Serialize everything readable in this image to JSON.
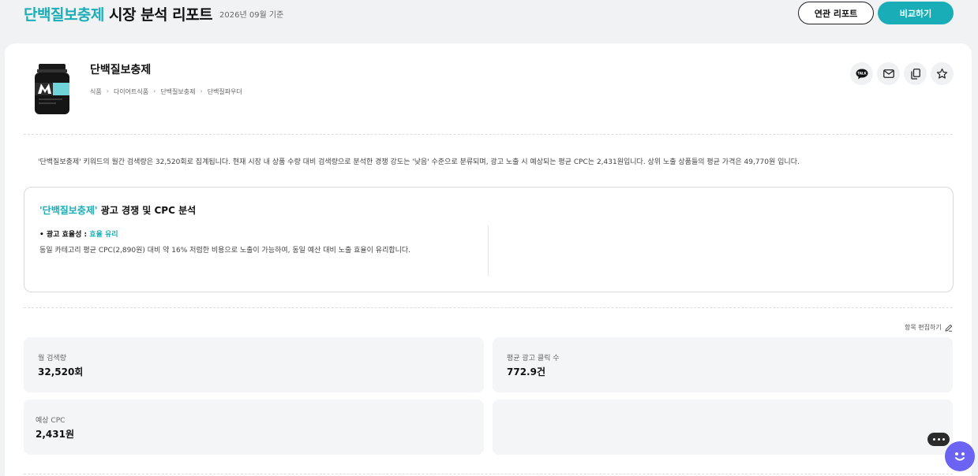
{
  "header": {
    "title_keyword": "단백질보충제",
    "title_rest": " 시장 분석 리포트",
    "date": "2026년 09월 기준",
    "related_report_label": "연관 리포트",
    "compare_label": "비교하기"
  },
  "product": {
    "name": "단백질보충제",
    "breadcrumb": [
      "식품",
      "다이어트식품",
      "단백질보충제",
      "단백질파우더"
    ],
    "breadcrumb_sep": "›",
    "actions": [
      "talk-icon",
      "mail-icon",
      "copy-icon",
      "star-icon"
    ],
    "talk_label": "TALK"
  },
  "summary": "'단백질보충제' 키워드의 월간 검색량은 32,520회로 집계됩니다. 현재 시장 내 상품 수량 대비 검색량으로 분석한 경쟁 강도는 '낮음' 수준으로 분류되며, 광고 노출 시 예상되는 평균 CPC는 2,431원입니다. 상위 노출 상품들의 평균 가격은 49,770원 입니다.",
  "cpc_analysis": {
    "title_keyword": "'단백질보충제'",
    "title_rest": " 광고 경쟁 및 CPC 분석",
    "efficiency_label": "• 광고 효율성 : ",
    "efficiency_value": "효율 유리",
    "description": "동일 카테고리 평균 CPC(2,890원) 대비 약 16% 저렴한 비용으로 노출이 가능하여, 동일 예산 대비 노출 효율이 유리합니다."
  },
  "edit_items_label": "항목 편집하기",
  "metrics": [
    {
      "label": "월 검색량",
      "value": "32,520회"
    },
    {
      "label": "평균 광고 클릭 수",
      "value": "772.9건"
    },
    {
      "label": "예상 CPC",
      "value": "2,431원"
    },
    {
      "label": "",
      "value": ""
    }
  ],
  "colors": {
    "accent": "#19aeb7",
    "chatbot": "#6c63f2",
    "background": "#f1f2f4"
  }
}
